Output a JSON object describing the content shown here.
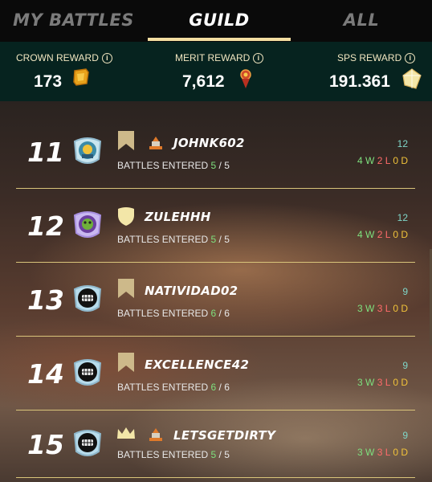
{
  "tabs": [
    {
      "label": "MY BATTLES",
      "active": false
    },
    {
      "label": "GUILD",
      "active": true
    },
    {
      "label": "ALL",
      "active": false
    }
  ],
  "rewards": {
    "crown": {
      "label": "CROWN REWARD",
      "value": "173",
      "icon": "crown-token-icon"
    },
    "merit": {
      "label": "MERIT REWARD",
      "value": "7,612",
      "icon": "merit-badge-icon"
    },
    "sps": {
      "label": "SPS REWARD",
      "value": "191.361",
      "icon": "sps-crystal-icon"
    }
  },
  "info_glyph": "i",
  "battles_label": "BATTLES ENTERED",
  "slash": "/",
  "rows": [
    {
      "rank": "11",
      "name": "JOHNK602",
      "tier": "banner",
      "guild_icon": true,
      "entered": "5",
      "total": "5",
      "score": "12",
      "w": "4",
      "l": "2",
      "d": "0"
    },
    {
      "rank": "12",
      "name": "ZULEHHH",
      "tier": "shield",
      "guild_icon": false,
      "entered": "5",
      "total": "5",
      "score": "12",
      "w": "4",
      "l": "2",
      "d": "0"
    },
    {
      "rank": "13",
      "name": "NATIVIDAD02",
      "tier": "banner",
      "guild_icon": false,
      "entered": "6",
      "total": "6",
      "score": "9",
      "w": "3",
      "l": "3",
      "d": "0"
    },
    {
      "rank": "14",
      "name": "EXCELLENCE42",
      "tier": "banner",
      "guild_icon": false,
      "entered": "6",
      "total": "6",
      "score": "9",
      "w": "3",
      "l": "3",
      "d": "0"
    },
    {
      "rank": "15",
      "name": "LETSGETDIRTY",
      "tier": "crown",
      "guild_icon": true,
      "entered": "5",
      "total": "5",
      "score": "9",
      "w": "3",
      "l": "3",
      "d": "0"
    }
  ],
  "colors": {
    "accent": "#f3dea1",
    "win": "#7ee07e",
    "loss": "#ff6b6b",
    "draw": "#f0c23a",
    "score": "#7fd6c8",
    "divider": "#d9c47a"
  }
}
